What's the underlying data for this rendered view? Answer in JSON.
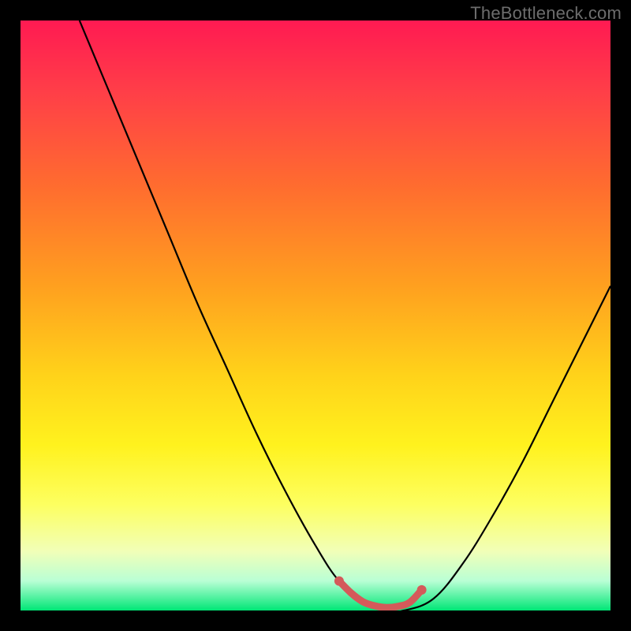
{
  "watermark": "TheBottleneck.com",
  "colors": {
    "frame": "#000000",
    "curve": "#000000",
    "marker": "#d45a5a",
    "gradient_top": "#ff1a52",
    "gradient_bottom": "#00e676"
  },
  "chart_data": {
    "type": "line",
    "title": "",
    "xlabel": "",
    "ylabel": "",
    "xlim": [
      0,
      100
    ],
    "ylim": [
      0,
      100
    ],
    "grid": false,
    "series": [
      {
        "name": "bottleneck-curve",
        "x": [
          10,
          15,
          20,
          25,
          30,
          35,
          40,
          45,
          50,
          54,
          58,
          62,
          65,
          70,
          75,
          80,
          85,
          90,
          95,
          100
        ],
        "values": [
          100,
          88,
          76,
          64,
          52,
          41,
          30,
          20,
          11,
          5,
          2,
          0,
          0,
          2,
          8,
          16,
          25,
          35,
          45,
          55
        ]
      },
      {
        "name": "optimal-segment",
        "x": [
          54,
          56,
          58,
          60,
          62,
          64,
          66,
          68
        ],
        "values": [
          5,
          3,
          1.5,
          0.8,
          0.5,
          0.7,
          1.4,
          3.5
        ]
      }
    ],
    "annotations": []
  }
}
